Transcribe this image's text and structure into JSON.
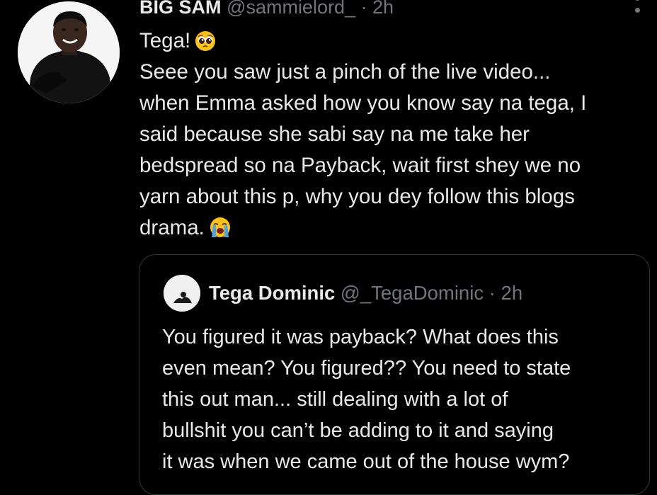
{
  "tweet": {
    "name": "BIG SAM",
    "handle": "@sammielord_",
    "separator": "·",
    "time": "2h",
    "body_lines": [
      "Tega!",
      "Seee you saw just a pinch of the live video...",
      "when Emma asked how you know say na tega, I",
      "said because she sabi say na me take her",
      "bedspread so na Payback, wait first shey we no",
      "yarn about this p, why you dey follow this blogs",
      "drama."
    ],
    "emojis": [
      "pleading-face",
      "loudly-crying-face"
    ]
  },
  "quoted_tweet": {
    "name": "Tega Dominic",
    "handle": "@_TegaDominic",
    "separator": "·",
    "time": "2h",
    "body_lines": [
      "You figured it was payback? What does this",
      "even mean? You figured?? You need to state",
      "this out man... still dealing with a lot of",
      "bullshit you can’t be adding to it and saying",
      "it was when we came out of the house wym?"
    ]
  },
  "colors": {
    "background": "#000000",
    "primary_text": "#e7e9ea",
    "secondary_text": "#71767b",
    "border": "#333639"
  }
}
